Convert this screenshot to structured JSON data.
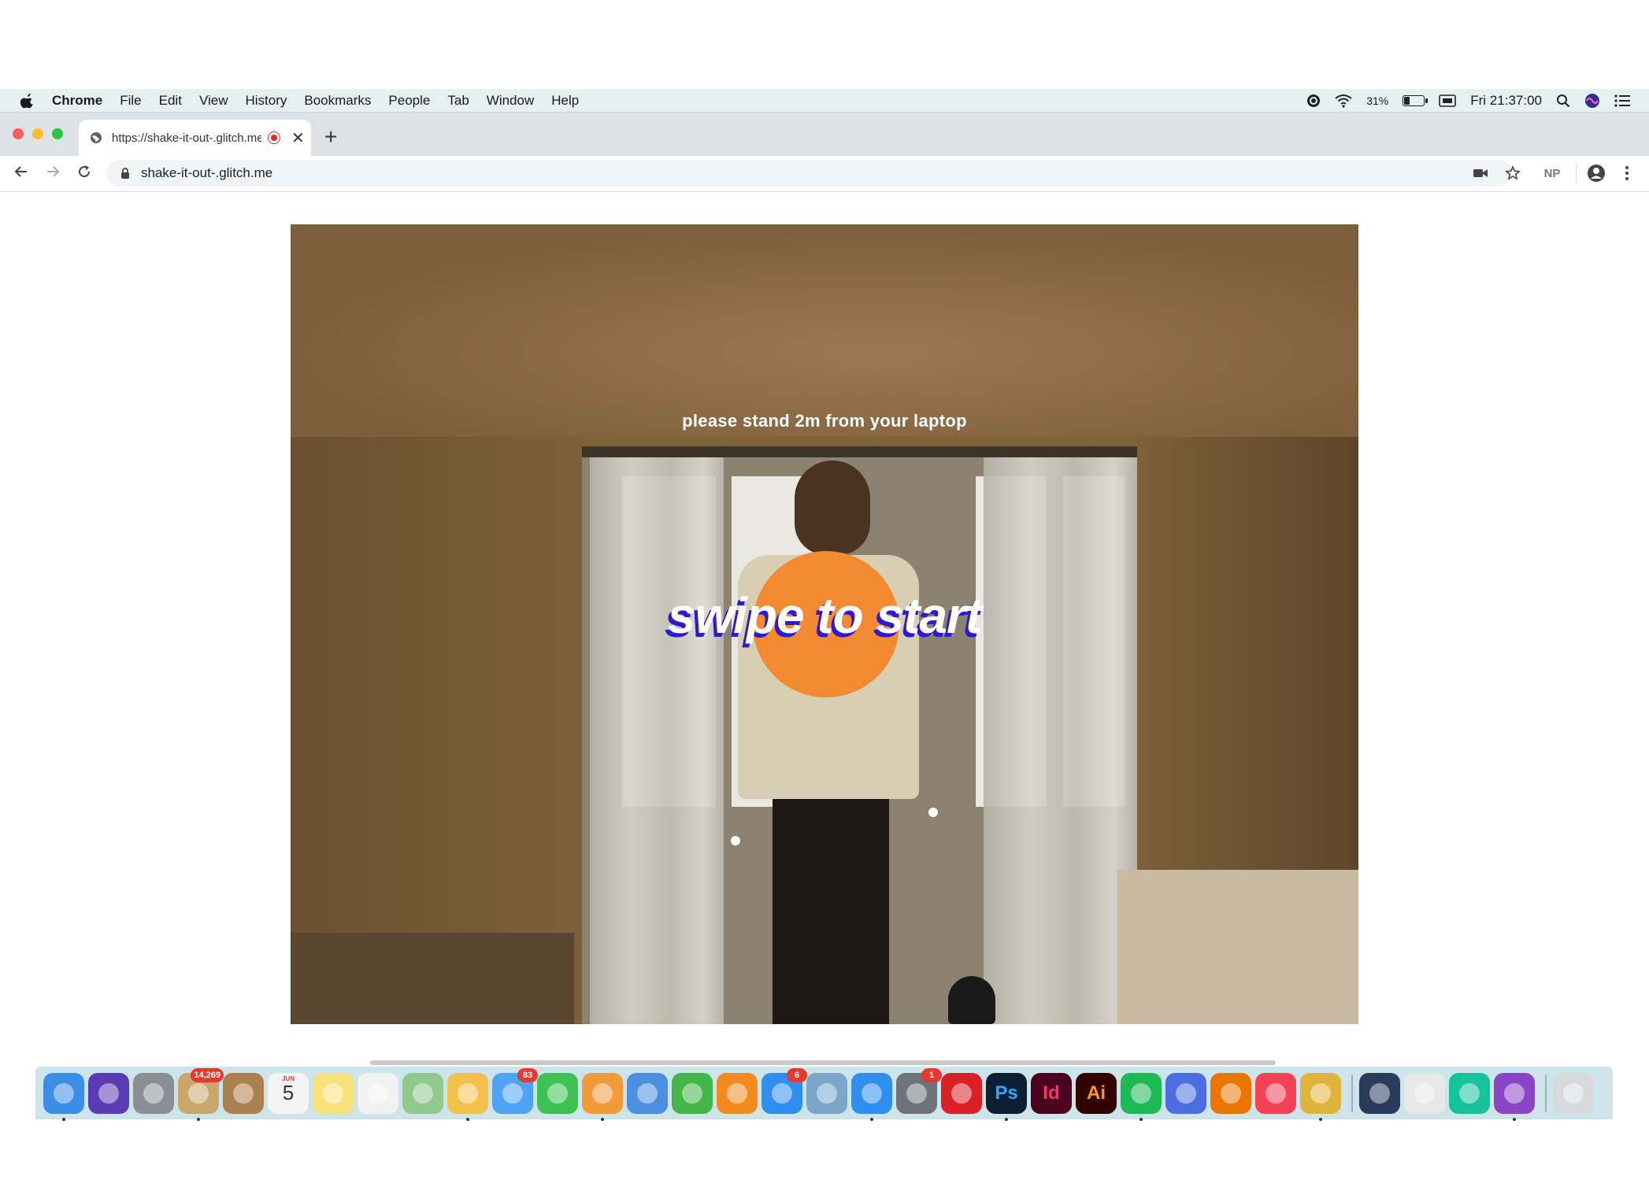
{
  "menubar": {
    "app_name": "Chrome",
    "items": [
      "File",
      "Edit",
      "View",
      "History",
      "Bookmarks",
      "People",
      "Tab",
      "Window",
      "Help"
    ],
    "battery": "31%",
    "battery_level": 0.31,
    "clock": "Fri 21:37:00"
  },
  "browser": {
    "tab_title": "https://shake-it-out-.glitch.me",
    "url": "shake-it-out-.glitch.me",
    "profile_initials": "NP"
  },
  "page": {
    "instruction": "please stand 2m from your laptop",
    "start_prompt": "swipe to start",
    "accent_orange": "#f28a32",
    "text_shadow_blue": "#2a1ad6"
  },
  "dock": {
    "items": [
      {
        "name": "finder",
        "icon": "finder-icon",
        "color": "#3a8ee6",
        "running": true
      },
      {
        "name": "siri",
        "icon": "siri-icon",
        "color": "#5b3bb5"
      },
      {
        "name": "launchpad",
        "icon": "rocket-icon",
        "color": "#8a8f96"
      },
      {
        "name": "mail",
        "icon": "mail-icon",
        "color": "#c9a76a",
        "badge": "14,269",
        "running": true
      },
      {
        "name": "contacts",
        "icon": "contacts-icon",
        "color": "#a9804e"
      },
      {
        "name": "calendar",
        "icon": "calendar-icon",
        "color": "#f4f4f4",
        "glyph": "5",
        "month": "JUN"
      },
      {
        "name": "notes",
        "icon": "notes-icon",
        "color": "#f7e27a"
      },
      {
        "name": "reminders",
        "icon": "reminders-icon",
        "color": "#f2f2f2"
      },
      {
        "name": "maps",
        "icon": "maps-icon",
        "color": "#8fc98b"
      },
      {
        "name": "photos",
        "icon": "photos-icon",
        "color": "#f3c14a",
        "running": true
      },
      {
        "name": "messages",
        "icon": "messages-icon",
        "color": "#4fa3f7",
        "badge": "83"
      },
      {
        "name": "facetime",
        "icon": "facetime-icon",
        "color": "#3cc152"
      },
      {
        "name": "pages",
        "icon": "pages-icon",
        "color": "#f09a3a",
        "running": true
      },
      {
        "name": "keynote",
        "icon": "keynote-icon",
        "color": "#4a8fe0"
      },
      {
        "name": "numbers",
        "icon": "numbers-icon",
        "color": "#43b549"
      },
      {
        "name": "books",
        "icon": "books-icon",
        "color": "#f28a1e"
      },
      {
        "name": "app-store",
        "icon": "app-store-icon",
        "color": "#2f8ff0",
        "badge": "6"
      },
      {
        "name": "preview",
        "icon": "preview-icon",
        "color": "#7aa6c9"
      },
      {
        "name": "safari",
        "icon": "safari-icon",
        "color": "#2f8ff0",
        "running": true
      },
      {
        "name": "system-preferences",
        "icon": "gear-icon",
        "color": "#6f7379",
        "badge": "1"
      },
      {
        "name": "creative-cloud",
        "icon": "creative-cloud-icon",
        "color": "#da1f26"
      },
      {
        "name": "photoshop",
        "icon": "photoshop-icon",
        "color": "#0c1f33",
        "glyph": "Ps",
        "glyph_color": "#31a8ff",
        "running": true
      },
      {
        "name": "indesign",
        "icon": "indesign-icon",
        "color": "#49021f",
        "glyph": "Id",
        "glyph_color": "#ff3366"
      },
      {
        "name": "illustrator",
        "icon": "illustrator-icon",
        "color": "#330000",
        "glyph": "Ai",
        "glyph_color": "#ff9a00"
      },
      {
        "name": "spotify",
        "icon": "spotify-icon",
        "color": "#1db954",
        "running": true
      },
      {
        "name": "sketch-app",
        "icon": "layers-icon",
        "color": "#4b6fe3"
      },
      {
        "name": "blender",
        "icon": "blender-icon",
        "color": "#ea7600"
      },
      {
        "name": "news",
        "icon": "news-icon",
        "color": "#f54155"
      },
      {
        "name": "chrome",
        "icon": "chrome-icon",
        "color": "#e0b43a",
        "running": true
      },
      {
        "name": "quicktime",
        "icon": "quicktime-icon",
        "color": "#2a3b5c"
      },
      {
        "name": "textedit",
        "icon": "textedit-icon",
        "color": "#e8e8e8"
      },
      {
        "name": "grammarly",
        "icon": "grammarly-icon",
        "color": "#15c39a"
      },
      {
        "name": "github-desktop",
        "icon": "github-icon",
        "color": "#8a45c7",
        "running": true
      },
      {
        "name": "trash",
        "icon": "trash-icon",
        "color": "#d6dadc"
      }
    ]
  }
}
